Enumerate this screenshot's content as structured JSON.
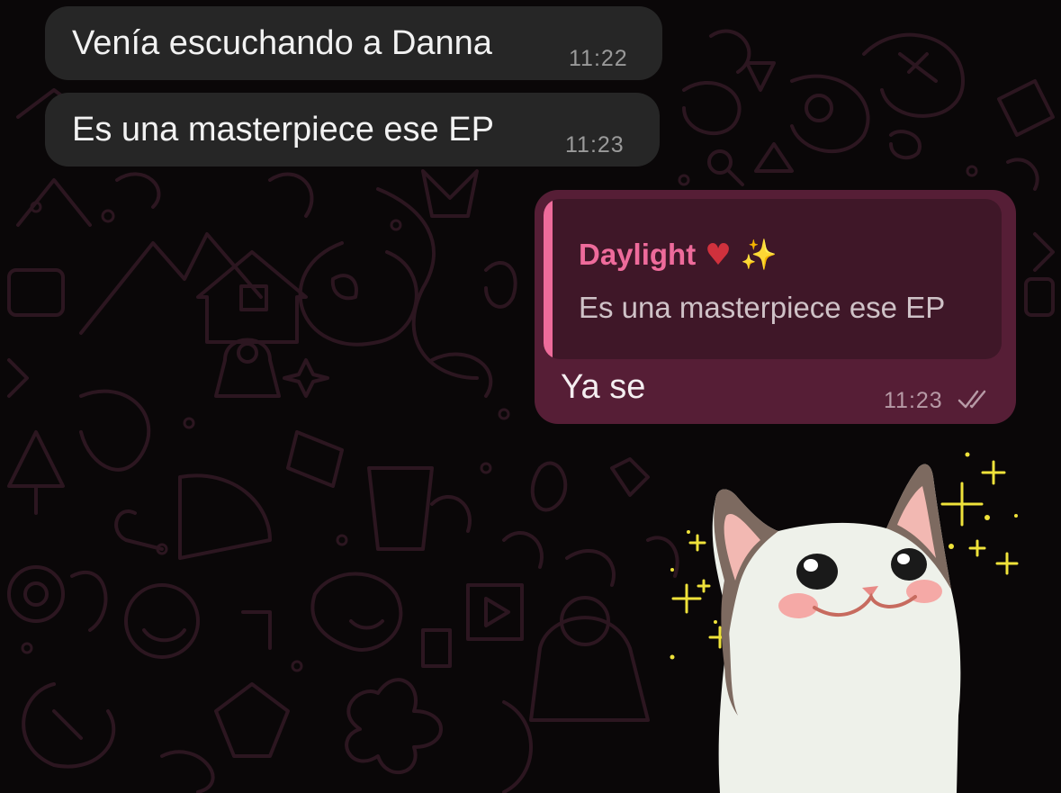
{
  "messages": {
    "incoming": [
      {
        "text": "Venía escuchando a Danna",
        "time": "11:22"
      },
      {
        "text": "Es una masterpiece ese EP",
        "time": "11:23"
      }
    ],
    "outgoing": {
      "reply_to": {
        "sender": "Daylight",
        "sender_emojis": [
          "anatomical-heart",
          "sparkles"
        ],
        "text": "Es una masterpiece ese EP"
      },
      "text": "Ya se",
      "time": "11:23",
      "status": "read"
    },
    "sticker": {
      "type": "cat-sticker"
    }
  },
  "colors": {
    "background": "#0a0708",
    "incoming_bubble": "#262626",
    "outgoing_bubble": "#561e36",
    "quote_bg": "#3f1728",
    "accent": "#ee6b9b"
  }
}
